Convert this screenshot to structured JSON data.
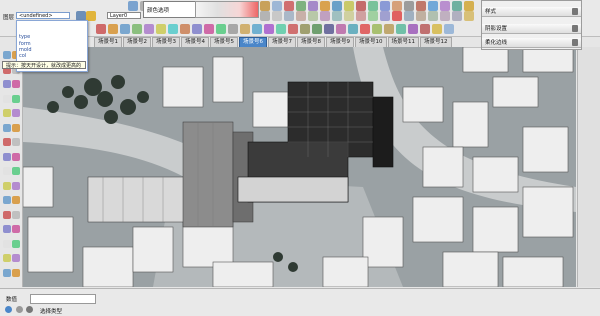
{
  "toolbar": {
    "layer_label": "图层",
    "layer_current": "<undefined>",
    "layer0_value": "Layer0",
    "color_label": "颜色选项"
  },
  "layer_dropdown": {
    "items": [
      "type",
      "form",
      "mold",
      "col"
    ]
  },
  "tooltip": "提示：按天开设计，就改成更高的",
  "tabs": [
    "场景号1",
    "场景号2",
    "场景号3",
    "场景号4",
    "场景号5",
    "场景号6",
    "场景号7",
    "场景号8",
    "场景号9",
    "场景号10",
    "场景号11",
    "场景号12"
  ],
  "active_tab": 5,
  "right_panel": {
    "rows": [
      "样式",
      "阴影设置",
      "柔化边线"
    ]
  },
  "status": {
    "measurement_label": "数值",
    "hint": "选择类型"
  },
  "colors": {
    "accent": "#4a86c9",
    "viewport_bg": "#9aa1a4",
    "building_light": "#efefef",
    "building_dark": "#2c2c2c"
  }
}
